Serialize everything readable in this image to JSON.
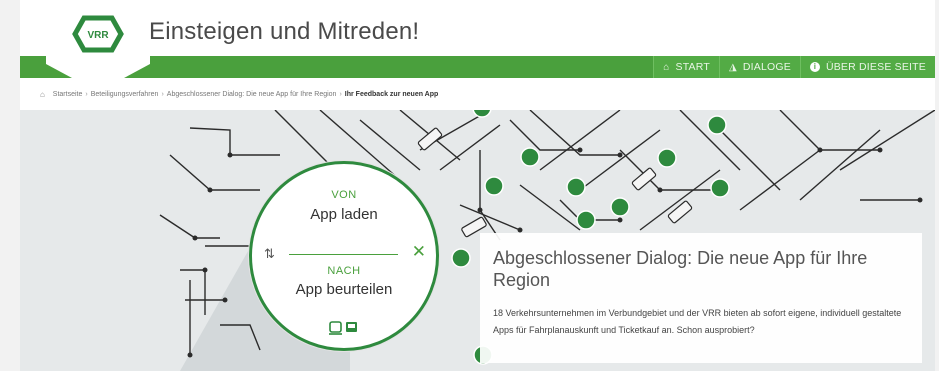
{
  "header": {
    "logo_text": "VRR",
    "site_title": "Einsteigen und Mitreden!"
  },
  "nav": [
    {
      "label": "START",
      "icon": "home-icon"
    },
    {
      "label": "DIALOGE",
      "icon": "chat-icon"
    },
    {
      "label": "ÜBER DIESE SEITE",
      "icon": "info-icon"
    }
  ],
  "breadcrumb": {
    "items": [
      "Startseite",
      "Beteiligungsverfahren",
      "Abgeschlossener Dialog: Die neue App für Ihre Region"
    ],
    "current": "Ihr Feedback zur neuen App"
  },
  "widget": {
    "from_label": "VON",
    "from_value": "App laden",
    "to_label": "NACH",
    "to_value": "App beurteilen",
    "swap_icon": "⇅",
    "close_icon": "✕",
    "transport_icons": "🚉🚌"
  },
  "card": {
    "title": "Abgeschlossener Dialog: Die neue App für Ihre Region",
    "text": "18 Verkehrsunternehmen im Verbundgebiet und der VRR bieten ab sofort eigene, individuell gestaltete Apps für Fahrplanauskunft und Ticketkauf an. Schon ausprobiert?"
  },
  "colors": {
    "brand_green": "#4aa03d",
    "dark_green": "#2e8a3e"
  }
}
